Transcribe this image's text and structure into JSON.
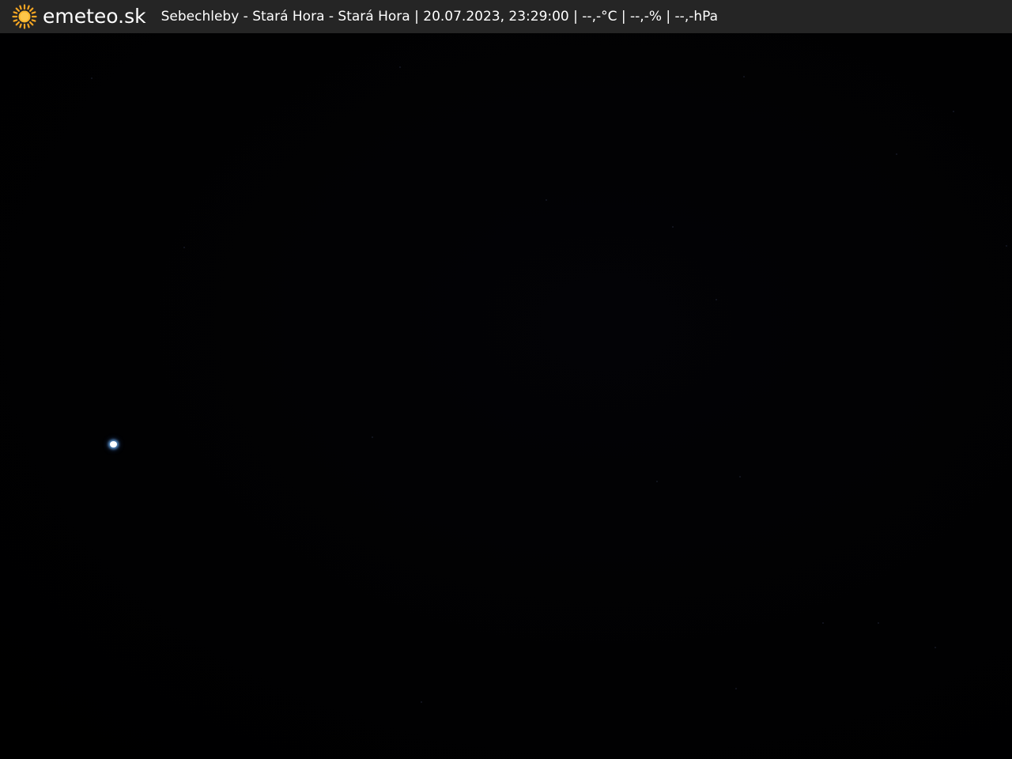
{
  "brand": {
    "name": "emeteo.sk",
    "icon": "sun-icon",
    "icon_color": "#f5a623"
  },
  "caption": {
    "location": "Sebechleby - Stará Hora - Stará Hora",
    "separator": "|",
    "datetime": "20.07.2023, 23:29:00",
    "temperature": "--,-°C",
    "humidity": "--,-%",
    "pressure": "--,-hPa"
  },
  "colors": {
    "bar_background": "#252525",
    "scene_background": "#020203",
    "text": "#ffffff"
  }
}
